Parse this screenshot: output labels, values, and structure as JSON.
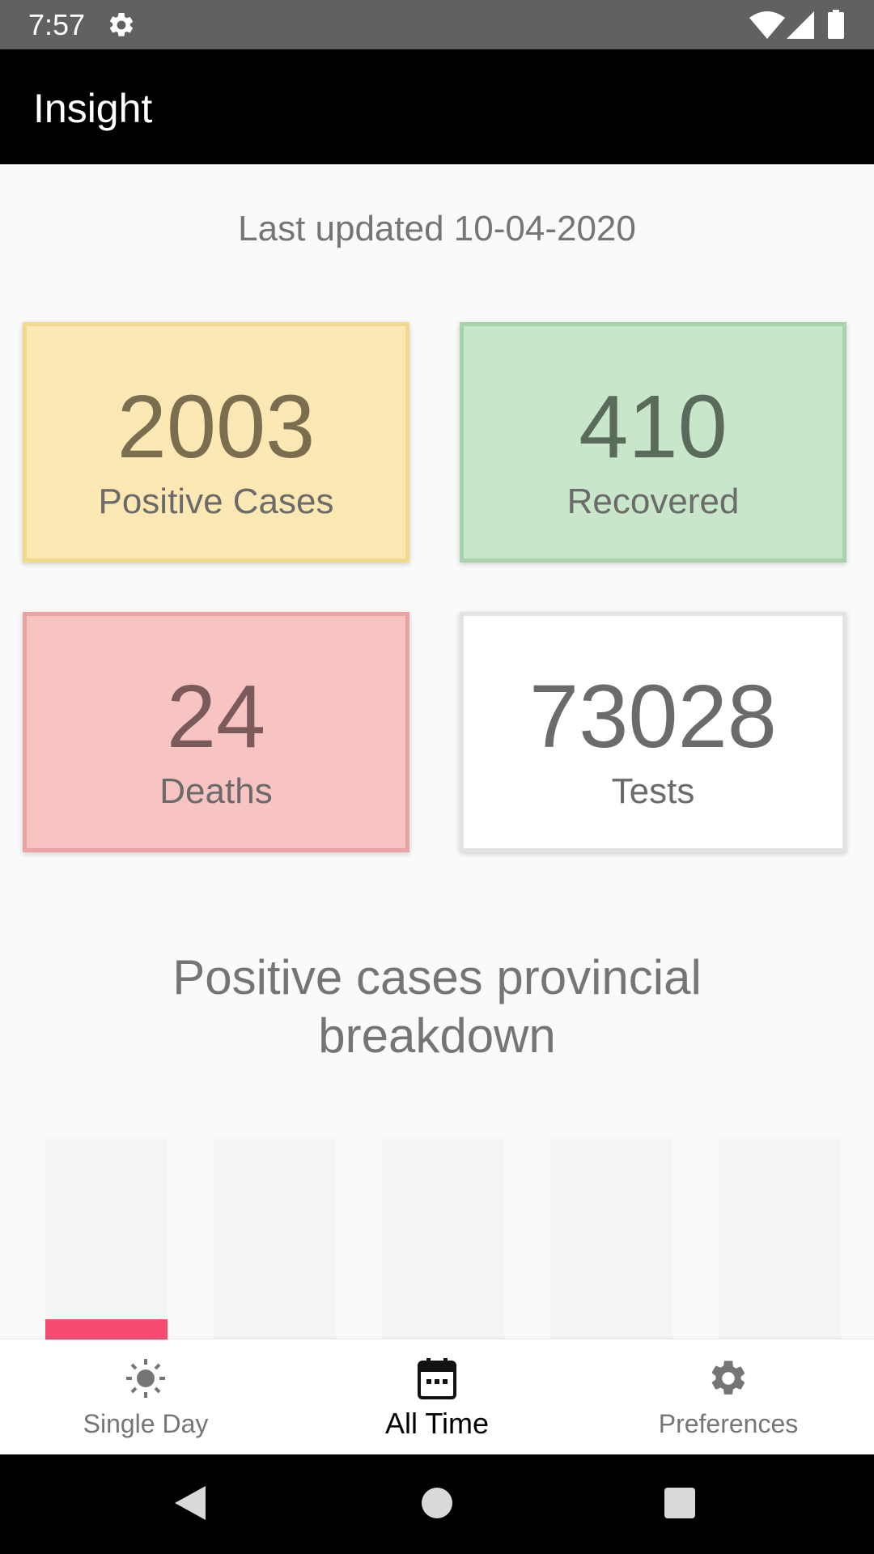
{
  "status_bar": {
    "time": "7:57",
    "icons": [
      "gear-icon",
      "wifi-icon",
      "signal-icon",
      "battery-icon"
    ]
  },
  "app_bar": {
    "title": "Insight"
  },
  "last_updated": "Last updated 10-04-2020",
  "stats": {
    "positive": {
      "value": "2003",
      "label": "Positive Cases",
      "color": "#fce8b2"
    },
    "recovered": {
      "value": "410",
      "label": "Recovered",
      "color": "#c8e6c9"
    },
    "deaths": {
      "value": "24",
      "label": "Deaths",
      "color": "#f8c4c2"
    },
    "tests": {
      "value": "73028",
      "label": "Tests",
      "color": "#ffffff"
    }
  },
  "section_title": "Positive cases provincial breakdown",
  "chart_data": {
    "type": "bar",
    "categories": [
      "",
      "",
      "",
      "",
      ""
    ],
    "values": [
      1,
      0,
      0,
      0,
      0
    ],
    "ylim": [
      0,
      10
    ],
    "bar_color": "#f74b6f",
    "track_color": "#f5f5f5",
    "grid": false
  },
  "bottom_nav": {
    "items": [
      {
        "label": "Single Day",
        "icon": "sun-icon",
        "active": false
      },
      {
        "label": "All Time",
        "icon": "calendar-icon",
        "active": true
      },
      {
        "label": "Preferences",
        "icon": "gear-icon",
        "active": false
      }
    ]
  },
  "system_nav": {
    "icons": [
      "back-icon",
      "home-icon",
      "recent-apps-icon"
    ]
  }
}
